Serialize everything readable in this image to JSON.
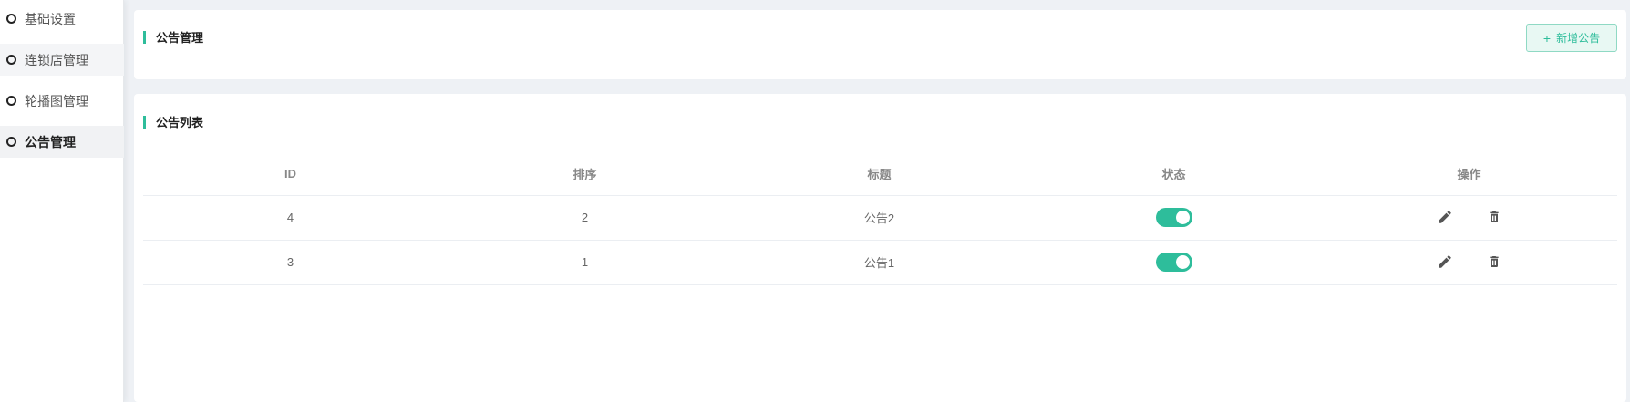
{
  "sidebar": {
    "items": [
      {
        "label": "基础设置",
        "state": "normal"
      },
      {
        "label": "连锁店管理",
        "state": "hover"
      },
      {
        "label": "轮播图管理",
        "state": "normal"
      },
      {
        "label": "公告管理",
        "state": "active"
      }
    ]
  },
  "header_card": {
    "title": "公告管理",
    "add_button_icon": "plus-icon",
    "add_button_label": "新增公告"
  },
  "list_card": {
    "title": "公告列表",
    "columns": [
      "ID",
      "排序",
      "标题",
      "状态",
      "操作"
    ],
    "rows": [
      {
        "id": "4",
        "order": "2",
        "title": "公告2",
        "status": true
      },
      {
        "id": "3",
        "order": "1",
        "title": "公告1",
        "status": true
      }
    ],
    "row_actions": [
      "edit-icon",
      "delete-icon"
    ]
  },
  "colors": {
    "accent": "#2ebd9b",
    "background": "#eef1f5",
    "toggle_on": "#2ebd9b"
  }
}
